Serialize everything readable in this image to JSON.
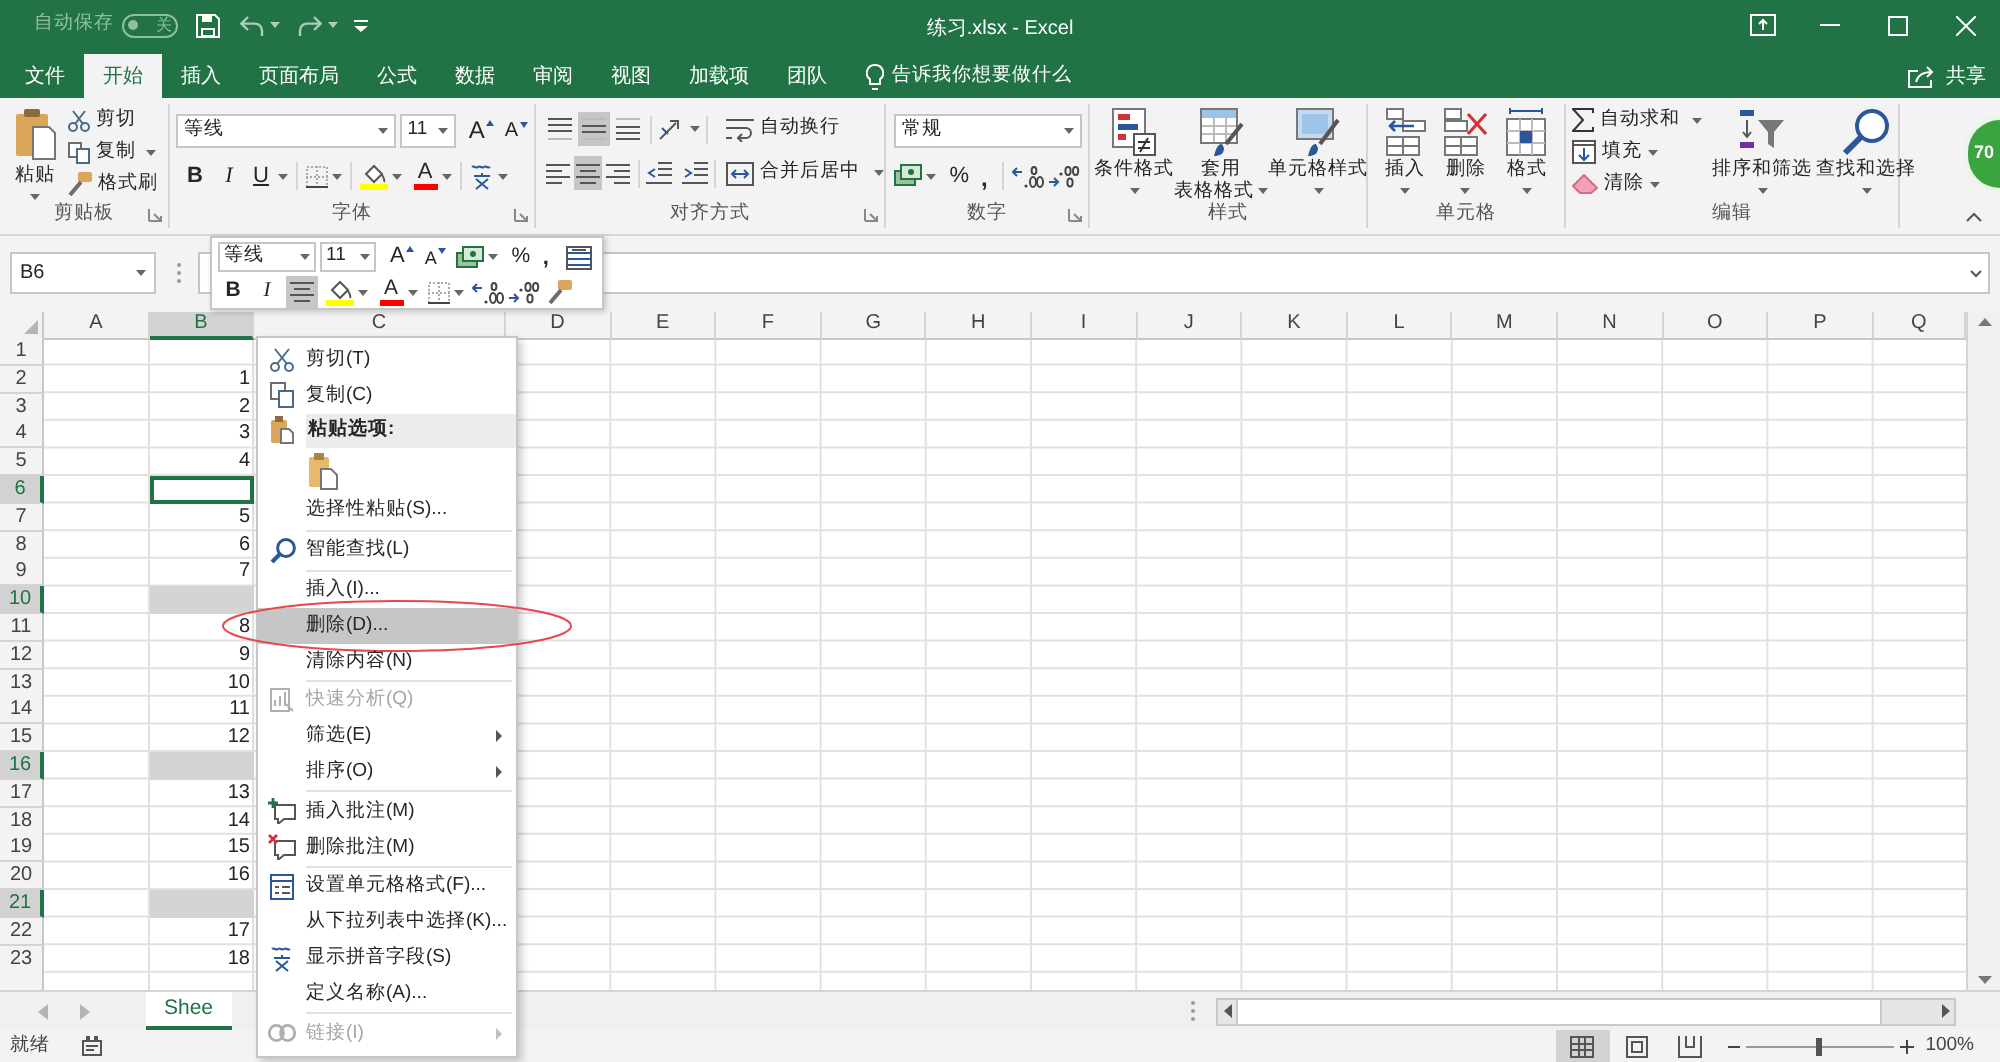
{
  "title_bar": {
    "autosave": {
      "label": "自动保存",
      "state": "关",
      "on": false
    },
    "title": "练习.xlsx - Excel"
  },
  "ribbon_tabs": [
    {
      "label": "文件",
      "selected": false
    },
    {
      "label": "开始",
      "selected": true
    },
    {
      "label": "插入",
      "selected": false
    },
    {
      "label": "页面布局",
      "selected": false
    },
    {
      "label": "公式",
      "selected": false
    },
    {
      "label": "数据",
      "selected": false
    },
    {
      "label": "审阅",
      "selected": false
    },
    {
      "label": "视图",
      "selected": false
    },
    {
      "label": "加载项",
      "selected": false
    },
    {
      "label": "团队",
      "selected": false
    }
  ],
  "tell_me": {
    "placeholder": "告诉我你想要做什么"
  },
  "share": {
    "label": "共享"
  },
  "ribbon": {
    "clipboard": {
      "paste": "粘贴",
      "cut": "剪切",
      "copy": "复制",
      "format_painter": "格式刷",
      "label": "剪贴板"
    },
    "font": {
      "font_name": "等线",
      "font_size": "11",
      "grow_font": "A",
      "shrink_font": "A",
      "bold": "B",
      "italic": "I",
      "underline": "U",
      "font_color": "A",
      "label": "字体"
    },
    "alignment": {
      "vertical": [
        {
          "selected": false
        },
        {
          "selected": true
        },
        {
          "selected": false
        }
      ],
      "wrap_text": "自动换行",
      "horizontal": [
        {
          "selected": false
        },
        {
          "selected": true
        },
        {
          "selected": false
        }
      ],
      "merge": "合并后居中",
      "label": "对齐方式"
    },
    "number": {
      "format": "常规",
      "percent": "%",
      "comma": ",",
      "label": "数字"
    },
    "styles": {
      "buttons": [
        {
          "lines": [
            "条件格式"
          ]
        },
        {
          "lines": [
            "套用",
            "表格格式"
          ]
        },
        {
          "lines": [
            "单元格样式"
          ]
        }
      ],
      "label": "样式"
    },
    "cells": {
      "buttons": [
        "插入",
        "删除",
        "格式"
      ],
      "label": "单元格"
    },
    "editing": {
      "autosum": "自动求和",
      "fill": "填充",
      "clear": "清除",
      "sort_filter": "排序和筛选",
      "find_select": "查找和选择",
      "label": "编辑"
    }
  },
  "formula_bar": {
    "name_box": "B6"
  },
  "mini_toolbar": {
    "font_name": "等线",
    "font_size": "11",
    "grow_font": "A",
    "shrink_font": "A",
    "percent": "%",
    "comma": ",",
    "bold": "B",
    "italic": "I",
    "font_color": "A",
    "center_selected": true
  },
  "sheet": {
    "columns": [
      {
        "label": "A",
        "selected": false
      },
      {
        "label": "B",
        "selected": true
      },
      {
        "label": "C",
        "selected": false
      },
      {
        "label": "D",
        "selected": false
      },
      {
        "label": "E",
        "selected": false
      },
      {
        "label": "F",
        "selected": false
      },
      {
        "label": "G",
        "selected": false
      },
      {
        "label": "H",
        "selected": false
      },
      {
        "label": "I",
        "selected": false
      },
      {
        "label": "J",
        "selected": false
      },
      {
        "label": "K",
        "selected": false
      },
      {
        "label": "L",
        "selected": false
      },
      {
        "label": "M",
        "selected": false
      },
      {
        "label": "N",
        "selected": false
      },
      {
        "label": "O",
        "selected": false
      },
      {
        "label": "P",
        "selected": false
      },
      {
        "label": "Q",
        "selected": false
      }
    ],
    "rows": [
      {
        "number": "1",
        "selected": false,
        "active": false
      },
      {
        "number": "2",
        "selected": false,
        "active": false,
        "value": "1"
      },
      {
        "number": "3",
        "selected": false,
        "active": false,
        "value": "2"
      },
      {
        "number": "4",
        "selected": false,
        "active": false,
        "value": "3"
      },
      {
        "number": "5",
        "selected": false,
        "active": false,
        "value": "4"
      },
      {
        "number": "6",
        "selected": true,
        "active": true
      },
      {
        "number": "7",
        "selected": false,
        "active": false,
        "value": "5"
      },
      {
        "number": "8",
        "selected": false,
        "active": false,
        "value": "6"
      },
      {
        "number": "9",
        "selected": false,
        "active": false,
        "value": "7"
      },
      {
        "number": "10",
        "selected": true,
        "active": false
      },
      {
        "number": "11",
        "selected": false,
        "active": false,
        "value": "8"
      },
      {
        "number": "12",
        "selected": false,
        "active": false,
        "value": "9"
      },
      {
        "number": "13",
        "selected": false,
        "active": false,
        "value": "10"
      },
      {
        "number": "14",
        "selected": false,
        "active": false,
        "value": "11"
      },
      {
        "number": "15",
        "selected": false,
        "active": false,
        "value": "12"
      },
      {
        "number": "16",
        "selected": true,
        "active": false
      },
      {
        "number": "17",
        "selected": false,
        "active": false,
        "value": "13"
      },
      {
        "number": "18",
        "selected": false,
        "active": false,
        "value": "14"
      },
      {
        "number": "19",
        "selected": false,
        "active": false,
        "value": "15"
      },
      {
        "number": "20",
        "selected": false,
        "active": false,
        "value": "16"
      },
      {
        "number": "21",
        "selected": true,
        "active": false
      },
      {
        "number": "22",
        "selected": false,
        "active": false,
        "value": "17"
      },
      {
        "number": "23",
        "selected": false,
        "active": false,
        "value": "18"
      }
    ]
  },
  "sheet_tabs": [
    {
      "label": "Shee",
      "selected": true
    }
  ],
  "status_bar": {
    "status": "就绪",
    "views": [
      {
        "selected": true
      },
      {
        "selected": false
      },
      {
        "selected": false
      }
    ],
    "zoom": {
      "level": 0.5,
      "label": "100%"
    }
  },
  "context_menu": {
    "items": [
      {
        "kind": "command",
        "label": "剪切(T)",
        "disabled": false,
        "highlighted": false,
        "submenu": false,
        "circled": false
      },
      {
        "kind": "command",
        "label": "复制(C)",
        "disabled": false,
        "highlighted": false,
        "submenu": false,
        "circled": false
      },
      {
        "kind": "header",
        "label": "粘贴选项:"
      },
      {
        "kind": "paste_options"
      },
      {
        "kind": "command",
        "label": "选择性粘贴(S)...",
        "disabled": false,
        "highlighted": false,
        "submenu": false,
        "circled": false
      },
      {
        "kind": "separator"
      },
      {
        "kind": "command",
        "label": "智能查找(L)",
        "disabled": false,
        "highlighted": false,
        "submenu": false,
        "circled": false
      },
      {
        "kind": "separator"
      },
      {
        "kind": "command",
        "label": "插入(I)...",
        "disabled": false,
        "highlighted": false,
        "submenu": false,
        "circled": false
      },
      {
        "kind": "command",
        "label": "删除(D)...",
        "disabled": false,
        "highlighted": true,
        "submenu": false,
        "circled": true
      },
      {
        "kind": "command",
        "label": "清除内容(N)",
        "disabled": false,
        "highlighted": false,
        "submenu": false,
        "circled": false
      },
      {
        "kind": "separator"
      },
      {
        "kind": "command",
        "label": "快速分析(Q)",
        "disabled": true,
        "highlighted": false,
        "submenu": false,
        "circled": false
      },
      {
        "kind": "command",
        "label": "筛选(E)",
        "disabled": false,
        "highlighted": false,
        "submenu": true,
        "circled": false
      },
      {
        "kind": "command",
        "label": "排序(O)",
        "disabled": false,
        "highlighted": false,
        "submenu": true,
        "circled": false
      },
      {
        "kind": "separator"
      },
      {
        "kind": "command",
        "label": "插入批注(M)",
        "disabled": false,
        "highlighted": false,
        "submenu": false,
        "circled": false
      },
      {
        "kind": "command",
        "label": "删除批注(M)",
        "disabled": false,
        "highlighted": false,
        "submenu": false,
        "circled": false
      },
      {
        "kind": "separator"
      },
      {
        "kind": "command",
        "label": "设置单元格格式(F)...",
        "disabled": false,
        "highlighted": false,
        "submenu": false,
        "circled": false
      },
      {
        "kind": "command",
        "label": "从下拉列表中选择(K)...",
        "disabled": false,
        "highlighted": false,
        "submenu": false,
        "circled": false
      },
      {
        "kind": "command",
        "label": "显示拼音字段(S)",
        "disabled": false,
        "highlighted": false,
        "submenu": false,
        "circled": false
      },
      {
        "kind": "command",
        "label": "定义名称(A)...",
        "disabled": false,
        "highlighted": false,
        "submenu": false,
        "circled": false
      },
      {
        "kind": "separator"
      },
      {
        "kind": "command",
        "label": "链接(I)",
        "disabled": true,
        "highlighted": false,
        "submenu": true,
        "circled": false
      }
    ]
  },
  "floating_badge": {
    "text": "70"
  }
}
